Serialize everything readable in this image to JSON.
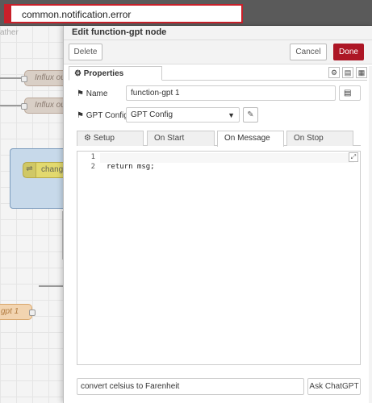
{
  "notification": {
    "text": "common.notification.error"
  },
  "workspace": {
    "tab_label": "ather",
    "nodes": [
      {
        "label": "Influx ou"
      },
      {
        "label": "Influx ou"
      },
      {
        "label": "change"
      },
      {
        "label": "gpt 1"
      }
    ]
  },
  "tray": {
    "title": "Edit function-gpt node",
    "delete_label": "Delete",
    "cancel_label": "Cancel",
    "done_label": "Done",
    "properties_tab": "Properties",
    "name_label": "Name",
    "name_value": "function-gpt 1",
    "config_label": "GPT Config",
    "config_value": "GPT Config",
    "subtabs": [
      "Setup",
      "On Start",
      "On Message",
      "On Stop"
    ],
    "active_subtab": "On Message",
    "code_lines": [
      {
        "num": "1",
        "text": ""
      },
      {
        "num": "2",
        "text": "return msg;"
      }
    ],
    "prompt_value": "convert celsius to Farenheit",
    "ask_label": "Ask ChatGPT"
  },
  "colors": {
    "accent": "#ad1625",
    "error": "#c8202a",
    "header": "#5a5a5a"
  },
  "icons": {
    "properties": "gear-icon",
    "name": "tag-icon",
    "config": "tag-icon",
    "setup": "gear-icon",
    "edit_config": "pencil-icon",
    "expand": "expand-icon",
    "settings": "gear-icon",
    "description": "document-icon",
    "appearance": "layout-icon",
    "icon_picker": "book-icon",
    "change_node": "shuffle-icon"
  }
}
